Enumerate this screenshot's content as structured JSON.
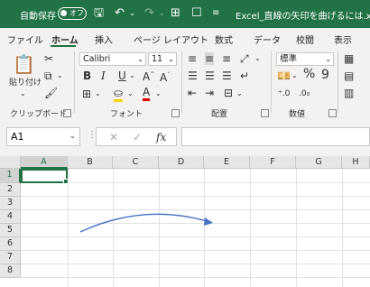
{
  "titlebar": {
    "autosave_label": "自動保存",
    "toggle_label": "オフ",
    "doc_title": "Excel_直線の矢印を曲げるには.xlsx"
  },
  "tabs": [
    "ファイル",
    "ホーム",
    "挿入",
    "ページ レイアウト",
    "数式",
    "データ",
    "校閲",
    "表示"
  ],
  "active_tab": "ホーム",
  "ribbon": {
    "clipboard": {
      "paste_label": "貼り付け",
      "group_label": "クリップボード"
    },
    "font": {
      "font_name": "Calibri",
      "font_size": "11",
      "group_label": "フォント",
      "bold": "B",
      "italic": "I",
      "underline": "U"
    },
    "alignment": {
      "group_label": "配置"
    },
    "number": {
      "format": "標準",
      "group_label": "数値",
      "percent": "%"
    }
  },
  "formula_bar": {
    "name_box": "A1",
    "fx_label": "fx",
    "content": ""
  },
  "sheet": {
    "columns": [
      "A",
      "B",
      "C",
      "D",
      "E",
      "F",
      "G",
      "H"
    ],
    "rows": [
      "1",
      "2",
      "3",
      "4",
      "5",
      "6",
      "7",
      "8"
    ],
    "selected_cell": "A1"
  },
  "colors": {
    "accent": "#217346",
    "arrow": "#4472c4"
  }
}
